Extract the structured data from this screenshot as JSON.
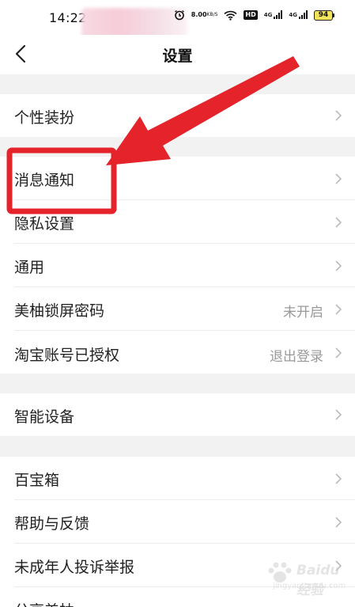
{
  "status_bar": {
    "time": "14:22",
    "net_speed_value": "8.00",
    "net_speed_unit": "KB/S",
    "hd_label": "HD",
    "signal_1_label": "4G",
    "signal_2_label": "4G",
    "battery_level": "94"
  },
  "header": {
    "title": "设置"
  },
  "settings": {
    "group1": [
      {
        "label": "个性装扮",
        "value": ""
      }
    ],
    "group2": [
      {
        "label": "消息通知",
        "value": ""
      },
      {
        "label": "隐私设置",
        "value": ""
      },
      {
        "label": "通用",
        "value": ""
      },
      {
        "label": "美柚锁屏密码",
        "value": "未开启"
      },
      {
        "label": "淘宝账号已授权",
        "value": "退出登录"
      }
    ],
    "group3": [
      {
        "label": "智能设备",
        "value": ""
      }
    ],
    "group4": [
      {
        "label": "百宝箱",
        "value": ""
      },
      {
        "label": "帮助与反馈",
        "value": ""
      },
      {
        "label": "未成年人投诉举报",
        "value": ""
      },
      {
        "label": "分享美柚",
        "value": ""
      }
    ]
  },
  "annotation": {
    "color": "#e5232a"
  },
  "watermark": {
    "text": "Baidu经验",
    "sub": "jingyan.baidu.com"
  }
}
